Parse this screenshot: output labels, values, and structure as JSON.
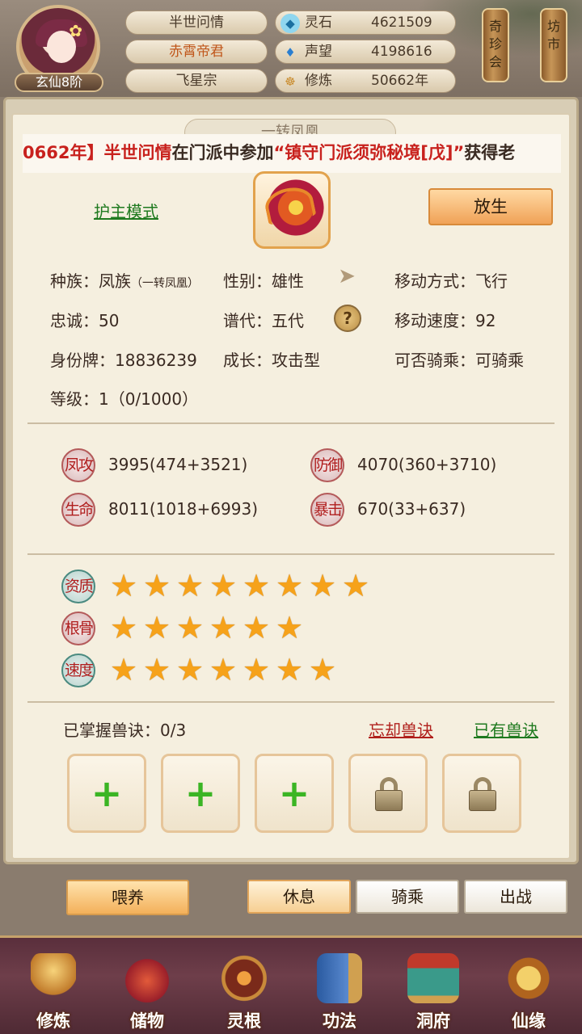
{
  "header": {
    "player_rank": "玄仙8阶",
    "name": "半世问情",
    "title": "赤霄帝君",
    "sect": "飞星宗",
    "stats": [
      {
        "icon": "spirit-stone-icon",
        "label": "灵石",
        "value": "4621509"
      },
      {
        "icon": "prestige-crystal-icon",
        "label": "声望",
        "value": "4198616"
      },
      {
        "icon": "meditation-icon",
        "label": "修炼",
        "value": "50662年"
      }
    ],
    "side_buttons": [
      {
        "label": "奇珍会"
      },
      {
        "label": "坊市"
      }
    ]
  },
  "pet": {
    "tab_title": "一转凤凰",
    "ticker": {
      "part1": "0662年】",
      "part2": "半世问情",
      "part3": "在门派中参加",
      "part4": "“镇守门派须弥秘境[戊]”",
      "part5": "获得老"
    },
    "guard_mode_label": "护主模式",
    "release_label": "放生",
    "race_label": "种族：",
    "race_value": "凤族",
    "race_sub": "（一转凤凰）",
    "gender_label": "性别：",
    "gender_value": "雄性",
    "move_type_label": "移动方式：",
    "move_type_value": "飞行",
    "loyalty_label": "忠诚：",
    "loyalty_value": "50",
    "lineage_label": "谱代：",
    "lineage_value": "五代",
    "move_speed_label": "移动速度：",
    "move_speed_value": "92",
    "id_label": "身份牌：",
    "id_value": "18836239",
    "growth_label": "成长：",
    "growth_value": "攻击型",
    "rideable_label": "可否骑乘：",
    "rideable_value": "可骑乘",
    "level_label": "等级：",
    "level_value": "1（0/1000）"
  },
  "combat": [
    {
      "badge": "凤攻",
      "value": "3995(474+3521)"
    },
    {
      "badge": "防御",
      "value": "4070(360+3710)"
    },
    {
      "badge": "生命",
      "value": "8011(1018+6993)"
    },
    {
      "badge": "暴击",
      "value": "670(33+637)"
    }
  ],
  "ratings": [
    {
      "label": "资质",
      "stars": 8
    },
    {
      "label": "根骨",
      "stars": 6
    },
    {
      "label": "速度",
      "stars": 7
    }
  ],
  "skills": {
    "mastered_label": "已掌握兽诀：0/3",
    "forget_label": "忘却兽诀",
    "owned_label": "已有兽诀",
    "slots": [
      "add",
      "add",
      "add",
      "locked",
      "locked"
    ]
  },
  "actions": {
    "feed_label": "喂养",
    "rest_label": "休息",
    "ride_label": "骑乘",
    "battle_label": "出战"
  },
  "nav": [
    {
      "label": "修炼",
      "icon": "cultivation-icon"
    },
    {
      "label": "储物",
      "icon": "storage-bag-icon"
    },
    {
      "label": "灵根",
      "icon": "spirit-root-icon"
    },
    {
      "label": "功法",
      "icon": "technique-book-icon"
    },
    {
      "label": "洞府",
      "icon": "cave-dwelling-icon"
    },
    {
      "label": "仙缘",
      "icon": "immortal-fate-icon"
    }
  ],
  "colors": {
    "accent_orange": "#f0a257",
    "star": "#f6a21a",
    "red_text": "#c8211d",
    "green_link": "#1f7a1f"
  }
}
